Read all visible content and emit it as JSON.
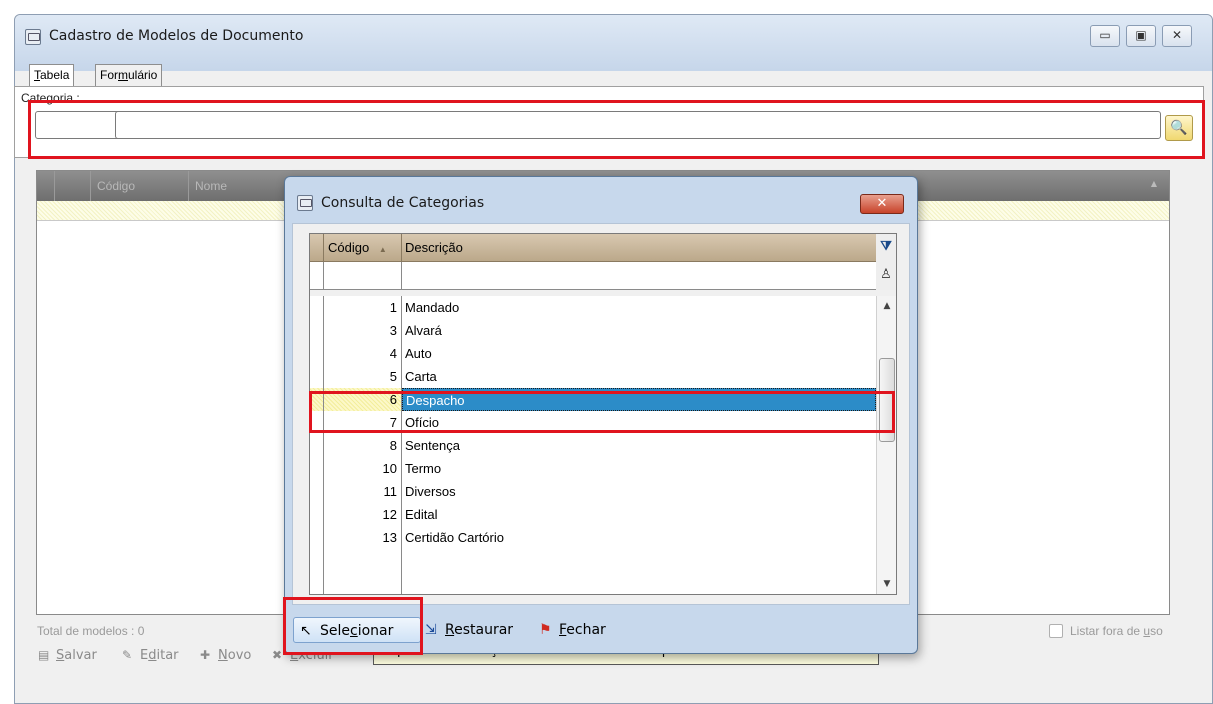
{
  "main_window": {
    "title": "Cadastro de Modelos de Documento",
    "controls": {
      "minimize": "▭",
      "maximize": "▣",
      "close": "✕"
    },
    "tabs": [
      {
        "label_prefix": "",
        "label_key": "T",
        "label_rest": "abela"
      },
      {
        "label_prefix": "For",
        "label_key": "m",
        "label_rest": "ulário"
      }
    ],
    "categoria": {
      "label": "Categoria :",
      "code_value": "",
      "name_value": ""
    },
    "grid": {
      "columns": [
        "Código",
        "Nome"
      ]
    },
    "total_models": "Total de modelos : 0",
    "listar_fora_de_uso": {
      "pre": "Listar fora de ",
      "key": "u",
      "post": "so"
    }
  },
  "toolbar": {
    "items": [
      {
        "icon": "▤",
        "key": "S",
        "rest": "alvar"
      },
      {
        "icon": "✎",
        "pre": "E",
        "key": "d",
        "rest": "itar"
      },
      {
        "icon": "✚",
        "key": "N",
        "rest": "ovo"
      },
      {
        "icon": "✖",
        "key": "E",
        "rest": "xcluir"
      }
    ],
    "tooltip": "Copia as informações da linha selecionada para a tela anterior"
  },
  "dialog": {
    "title": "Consulta de Categorias",
    "close": "✕",
    "columns": [
      "Código",
      "Descrição"
    ],
    "rows": [
      {
        "code": "1",
        "desc": "Mandado"
      },
      {
        "code": "3",
        "desc": "Alvará"
      },
      {
        "code": "4",
        "desc": "Auto"
      },
      {
        "code": "5",
        "desc": "Carta"
      },
      {
        "code": "6",
        "desc": "Despacho",
        "selected": true
      },
      {
        "code": "7",
        "desc": "Ofício"
      },
      {
        "code": "8",
        "desc": "Sentença"
      },
      {
        "code": "10",
        "desc": "Termo"
      },
      {
        "code": "11",
        "desc": "Diversos"
      },
      {
        "code": "12",
        "desc": "Edital"
      },
      {
        "code": "13",
        "desc": "Certidão Cartório"
      }
    ],
    "buttons": {
      "selecionar": {
        "pre": "Sele",
        "key": "c",
        "post": "ionar"
      },
      "restaurar": {
        "pre": "",
        "key": "R",
        "post": "estaurar"
      },
      "fechar": {
        "pre": "",
        "key": "F",
        "post": "echar"
      }
    }
  },
  "colors": {
    "highlight_frame": "#e0141e",
    "selected_row": "#2c8cc8",
    "tooltip_bg": "#ffffe1"
  }
}
